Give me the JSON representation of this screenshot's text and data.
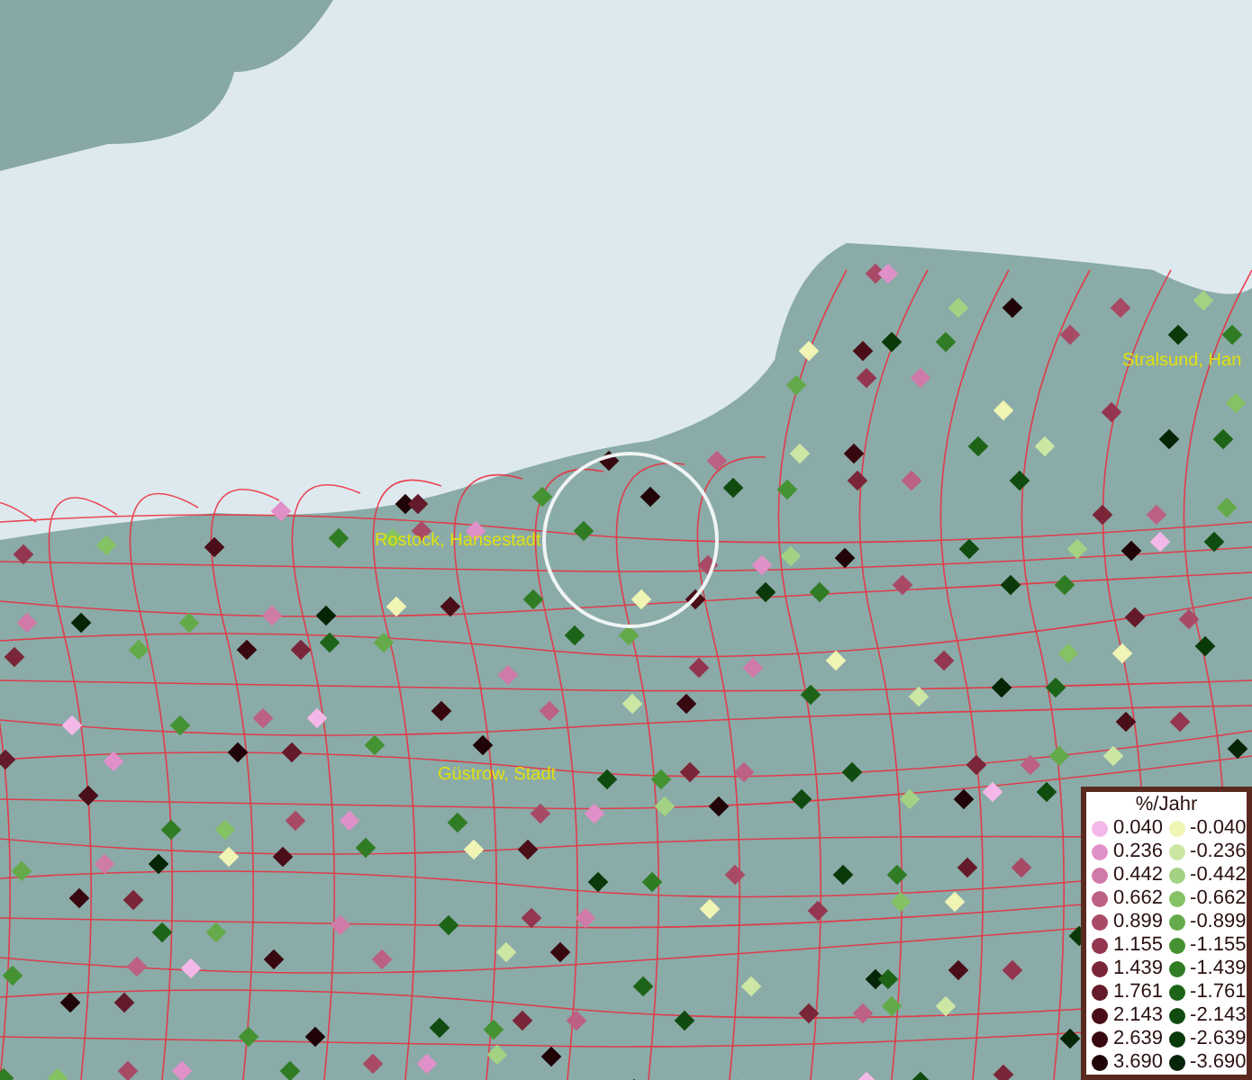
{
  "map": {
    "places": [
      {
        "name": "Rostock, Hansestadt"
      },
      {
        "name": "Güstrow, Stadt"
      },
      {
        "name": "Stralsund, Han"
      }
    ]
  },
  "legend": {
    "title": "%/Jahr",
    "columns": [
      [
        {
          "label": "0.040",
          "color": "#f4b8e8"
        },
        {
          "label": "0.236",
          "color": "#e090c8"
        },
        {
          "label": "0.442",
          "color": "#d07aa8"
        },
        {
          "label": "0.662",
          "color": "#bc6084"
        },
        {
          "label": "0.899",
          "color": "#a84a66"
        },
        {
          "label": "1.155",
          "color": "#943650"
        },
        {
          "label": "1.439",
          "color": "#7a2638"
        },
        {
          "label": "1.761",
          "color": "#641a2a"
        },
        {
          "label": "2.143",
          "color": "#4a0e18"
        },
        {
          "label": "2.639",
          "color": "#380810"
        },
        {
          "label": "3.690",
          "color": "#200408"
        }
      ],
      [
        {
          "label": "-0.040",
          "color": "#f0f4b4"
        },
        {
          "label": "-0.236",
          "color": "#cce6a4"
        },
        {
          "label": "-0.442",
          "color": "#a4d284"
        },
        {
          "label": "-0.662",
          "color": "#84c264"
        },
        {
          "label": "-0.899",
          "color": "#64aa4a"
        },
        {
          "label": "-1.155",
          "color": "#449232"
        },
        {
          "label": "-1.439",
          "color": "#307c24"
        },
        {
          "label": "-1.761",
          "color": "#1e6418"
        },
        {
          "label": "-2.143",
          "color": "#104c10"
        },
        {
          "label": "-2.639",
          "color": "#0a3a0a"
        },
        {
          "label": "-3.690",
          "color": "#062406"
        }
      ]
    ]
  }
}
